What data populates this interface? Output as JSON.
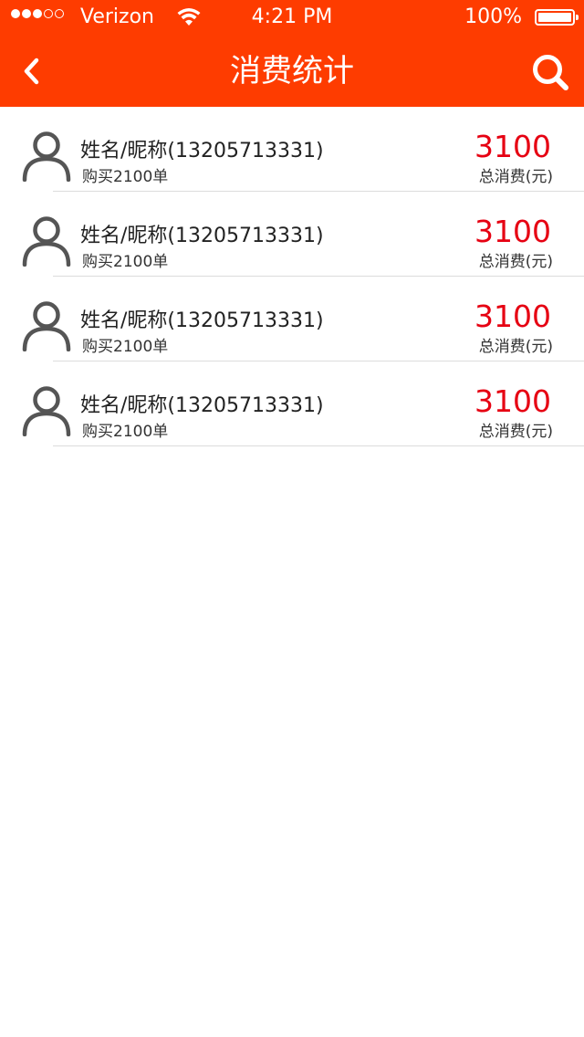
{
  "status_bar": {
    "carrier": "Verizon",
    "time": "4:21 PM",
    "battery": "100%",
    "signal_bars_filled": 3,
    "signal_bars_total": 5
  },
  "nav": {
    "title": "消费统计",
    "back_icon": "chevron-left-icon",
    "search_icon": "search-icon"
  },
  "colors": {
    "brand": "#fe3c00",
    "amount": "#e60012",
    "divider": "#dcdcdc"
  },
  "list": {
    "items": [
      {
        "name": "姓名/昵称(13205713331)",
        "orders": "购买2100单",
        "amount": "3100",
        "amount_label": "总消费(元)"
      },
      {
        "name": "姓名/昵称(13205713331)",
        "orders": "购买2100单",
        "amount": "3100",
        "amount_label": "总消费(元)"
      },
      {
        "name": "姓名/昵称(13205713331)",
        "orders": "购买2100单",
        "amount": "3100",
        "amount_label": "总消费(元)"
      },
      {
        "name": "姓名/昵称(13205713331)",
        "orders": "购买2100单",
        "amount": "3100",
        "amount_label": "总消费(元)"
      }
    ]
  }
}
